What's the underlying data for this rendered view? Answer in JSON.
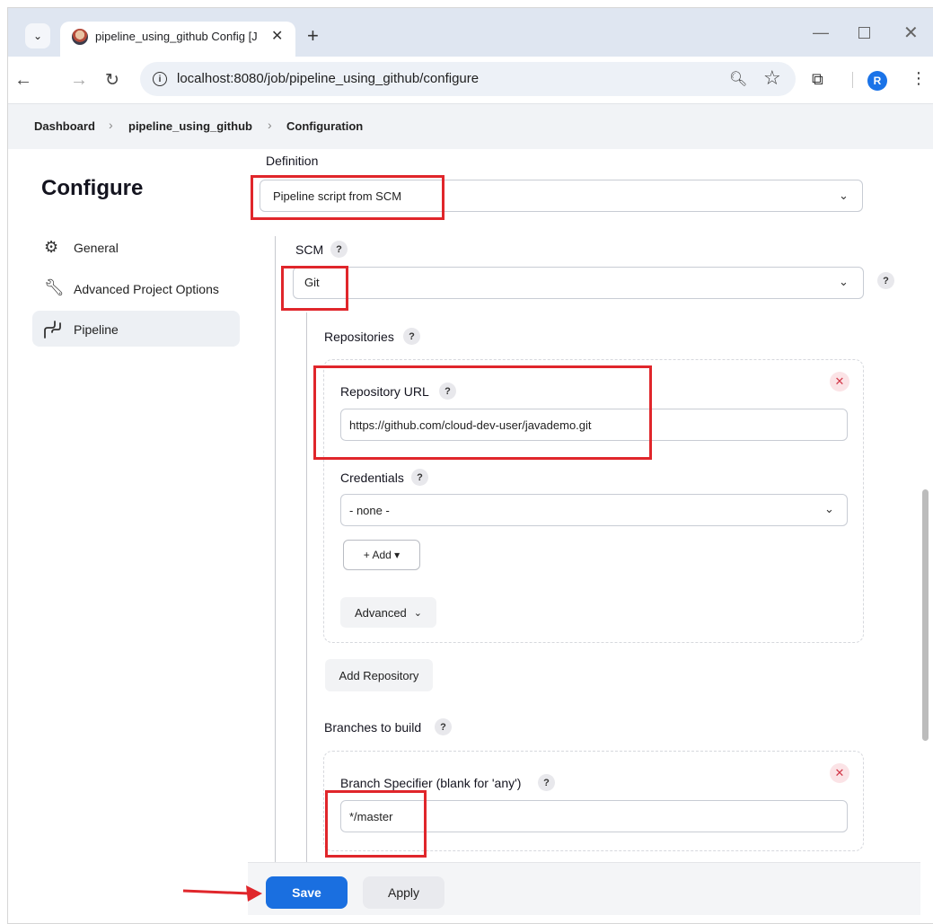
{
  "browser": {
    "tab_title": "pipeline_using_github Config [J",
    "new_tab": "+",
    "url": "localhost:8080/job/pipeline_using_github/configure",
    "profile_initial": "R"
  },
  "breadcrumb": [
    "Dashboard",
    "pipeline_using_github",
    "Configuration"
  ],
  "sidebar": {
    "title": "Configure",
    "items": [
      {
        "label": "General",
        "icon": "gear-icon"
      },
      {
        "label": "Advanced Project Options",
        "icon": "wrench-icon"
      },
      {
        "label": "Pipeline",
        "icon": "pipeline-icon"
      }
    ]
  },
  "form": {
    "definition_label": "Definition",
    "definition_value": "Pipeline script from SCM",
    "scm_label": "SCM",
    "scm_value": "Git",
    "repositories_label": "Repositories",
    "repo_url_label": "Repository URL",
    "repo_url_value": "https://github.com/cloud-dev-user/javademo.git",
    "credentials_label": "Credentials",
    "credentials_value": "- none -",
    "add_button": "+ Add ▾",
    "advanced_button": "Advanced",
    "add_repository_button": "Add Repository",
    "branches_label": "Branches to build",
    "branch_specifier_label": "Branch Specifier (blank for 'any')",
    "branch_specifier_value": "*/master"
  },
  "footer": {
    "save_label": "Save",
    "apply_label": "Apply"
  },
  "colors": {
    "annotation_red": "#e0262b",
    "primary_blue": "#1a6fe0"
  }
}
